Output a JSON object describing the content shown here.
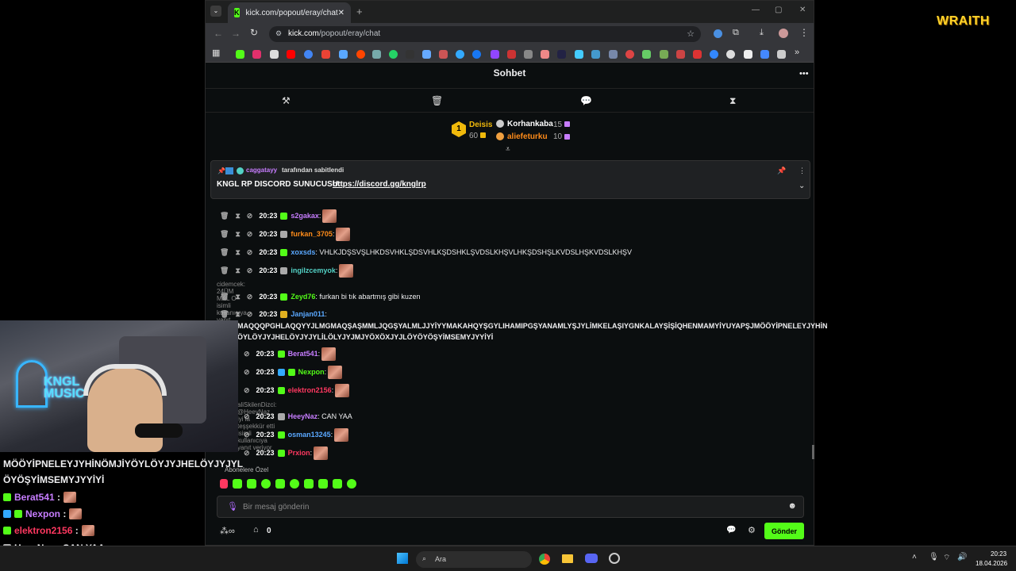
{
  "browser": {
    "tab_title": "kick.com/popout/eray/chat",
    "url_domain": "kick.com",
    "url_path": "/popout/eray/chat"
  },
  "chat": {
    "title": "Sohbet",
    "leaderboard": [
      {
        "rank": "1",
        "name": "Deisis",
        "points": "60"
      },
      {
        "name": "Korhankaba",
        "points": "15"
      },
      {
        "name": "aliefeturku",
        "points": "10"
      }
    ],
    "pinned": {
      "by_user": "caggatayy",
      "by_label": "tarafından sabitlendi",
      "message": "KNGL RP DISCORD SUNUCUSU:",
      "link": "https://discord.gg/knglrp"
    },
    "messages": [
      {
        "time": "20:23",
        "user": "s2gakax",
        "color": "#c77dff",
        "text": "",
        "emote": true
      },
      {
        "time": "20:23",
        "user": "furkan_3705",
        "color": "#ff8c1a",
        "text": "",
        "emote": true
      },
      {
        "time": "20:23",
        "user": "xoxsds",
        "color": "#5aa8ff",
        "text": "VHLKJDŞSVŞLHKDSVHKLŞDSVHLKŞDSHKLŞVDSLKHŞVLHKŞDSHŞLKVDSLHŞKVDSLKHŞV",
        "emote": false
      },
      {
        "time": "20:23",
        "user": "ingilzcemyok",
        "color": "#53d1c5",
        "text": "",
        "emote": true
      },
      {
        "time": "20:23",
        "user": "Zeyd76",
        "color": "#53fc18",
        "text": "furkan bi tık abartmış gibi kuzen",
        "emote": false,
        "reply": "cidemcek: 24ÜM MAL O isimli kullanıcıya yanıt veriyor"
      },
      {
        "time": "20:23",
        "user": "Janjan011",
        "color": "#5aa8ff",
        "text": "",
        "emote": false
      },
      {
        "time": "20:23",
        "user": "Berat541",
        "color": "#c77dff",
        "text": "",
        "emote": true
      },
      {
        "time": "20:23",
        "user": "Nexpon",
        "color": "#53fc18",
        "text": "",
        "emote": true
      },
      {
        "time": "20:23",
        "user": "elektron2156",
        "color": "#ff3860",
        "text": "",
        "emote": true
      },
      {
        "time": "20:23",
        "user": "HeeyNaz",
        "color": "#c77dff",
        "text": "CAN YAA",
        "emote": false,
        "reply": "aliSkilenDizci: @HeeyNaz iyi la teşşekkür etti isimli kullanıcıya yanıt veriyor"
      },
      {
        "time": "20:23",
        "user": "osman13245",
        "color": "#5aa8ff",
        "text": "",
        "emote": true
      },
      {
        "time": "20:23",
        "user": "Prxion",
        "color": "#ff3860",
        "text": "",
        "emote": true
      }
    ],
    "janjan_line1": "MAQQQPGHLAQQYYJLMGMAQŞAŞMMLJQGŞYALMLJJYİYYMAKAHQYŞGYLIHAMIPGŞYANAMLYŞJYLİMKELAŞIYGNKALAYŞİŞİQHENMAMYİYUYAPŞJMÖÖYİPNELEYJYHİN",
    "janjan_line2": "ÖYLÖYJYJHELÖYJYJYLİLÖLYJYJMJYÖXÖXJYJLÖYÖYÖŞYİMSEMYJYYİYİ",
    "subs_only": "Abonelere Özel",
    "input_placeholder": "Bir mesaj gönderin",
    "points_count": "0",
    "send_label": "Gönder"
  },
  "overlay": {
    "neon_line1": "KNGL",
    "neon_line2": "MUSIC",
    "wraith_logo": "WRAITH",
    "text_line1": "MÖÖYİPNELEYJYHİNÖMJİYÖYLÖYJYJHELÖYJYJYL",
    "text_line2": "ÖYÖŞYİMSEMYJYYİYİ",
    "messages": [
      {
        "user": "Berat541",
        "color": "#c77dff",
        "text": ":",
        "emote": true
      },
      {
        "user": "Nexpon",
        "color": "#c77dff",
        "text": ":",
        "emote": true
      },
      {
        "user": "elektron2156",
        "color": "#ff3860",
        "text": ":",
        "emote": true
      },
      {
        "user": "HeeyNaz",
        "color": "#ffffff",
        "text": ": CAN YAA",
        "emote": false
      },
      {
        "user": "osman13245",
        "color": "#5aa8ff",
        "text": ":",
        "emote": true
      }
    ]
  },
  "taskbar": {
    "search_placeholder": "Ara",
    "time": "20:23",
    "date": "18.04.2026"
  }
}
